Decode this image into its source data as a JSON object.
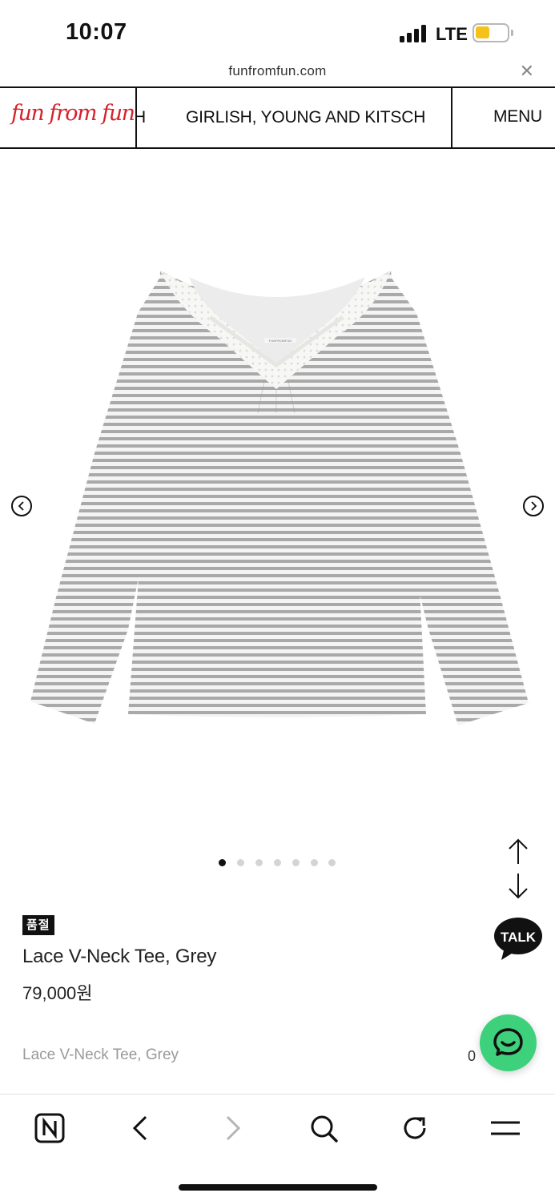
{
  "status_bar": {
    "time": "10:07",
    "network": "LTE",
    "battery_color": "#f6c21a"
  },
  "browser": {
    "url": "funfromfun.com",
    "close_icon": "close-icon"
  },
  "site_header": {
    "logo_text": "fun from fun",
    "logo_color": "#d6222d",
    "marquee_prev_fragment": "H",
    "marquee_text": "GIRLISH, YOUNG AND KITSCH",
    "menu_label": "MENU"
  },
  "gallery": {
    "image_alt": "grey striped lace v-neck long sleeve tee",
    "image_label_text": "FUNFROMFUN",
    "slide_count": 7,
    "active_slide": 1,
    "prev_icon": "chevron-left-circle-icon",
    "next_icon": "chevron-right-circle-icon"
  },
  "product": {
    "soldout_badge": "품절",
    "name": "Lace V-Neck Tee, Grey",
    "price": "79,000원"
  },
  "floating": {
    "talk_label": "TALK",
    "scroll_up_icon": "arrow-up-icon",
    "scroll_down_icon": "arrow-down-icon",
    "chat_icon": "chat-smile-icon",
    "chat_color": "#3ed17b"
  },
  "summary": {
    "name": "Lace V-Neck Tee, Grey",
    "count": "0"
  },
  "toolbar": {
    "items": [
      "naver-home-icon",
      "back-icon",
      "forward-icon",
      "search-icon",
      "reload-icon",
      "menu-icon"
    ]
  }
}
